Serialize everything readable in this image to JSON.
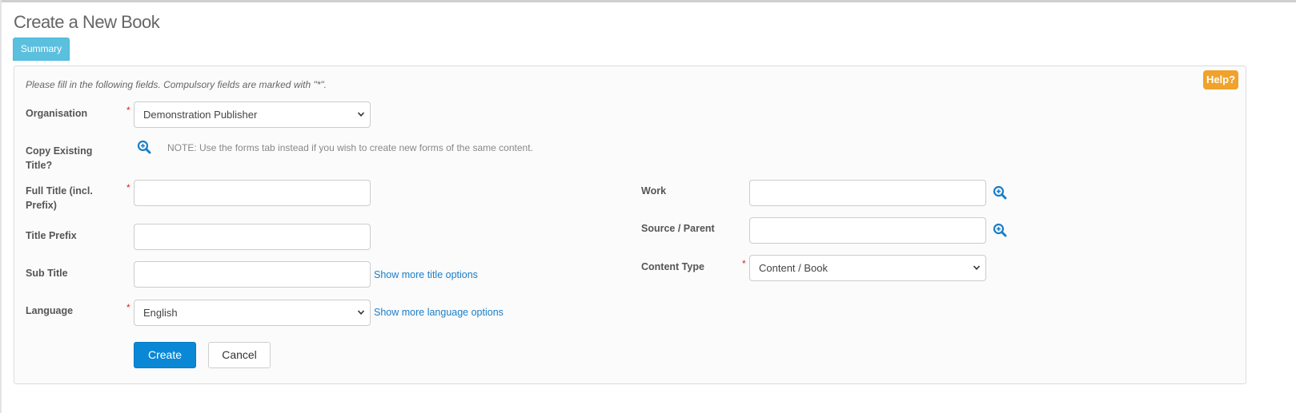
{
  "page": {
    "title": "Create a New Book",
    "tab_summary": "Summary",
    "help": "Help?",
    "intro": "Please fill in the following fields. Compulsory fields are marked with \"*\"."
  },
  "form": {
    "required_mark": "*",
    "organisation": {
      "label": "Organisation",
      "value": "Demonstration Publisher"
    },
    "copy_existing": {
      "label": "Copy Existing Title?",
      "note": "NOTE: Use the forms tab instead if you wish to create new forms of the same content."
    },
    "full_title": {
      "label": "Full Title (incl. Prefix)",
      "value": ""
    },
    "title_prefix": {
      "label": "Title Prefix",
      "value": ""
    },
    "sub_title": {
      "label": "Sub Title",
      "value": "",
      "more_link": "Show more title options"
    },
    "language": {
      "label": "Language",
      "value": "English",
      "more_link": "Show more language options"
    },
    "work": {
      "label": "Work",
      "value": ""
    },
    "source_parent": {
      "label": "Source / Parent",
      "value": ""
    },
    "content_type": {
      "label": "Content Type",
      "value": "Content / Book"
    }
  },
  "actions": {
    "create": "Create",
    "cancel": "Cancel"
  },
  "colors": {
    "accent": "#0a88d6",
    "tab": "#5bc0de",
    "help": "#f0a22b",
    "required": "#e02020",
    "link": "#1a7ec8"
  },
  "icons": {
    "lookup": "zoom-in-icon",
    "dropdown": "chevron-down-icon"
  }
}
